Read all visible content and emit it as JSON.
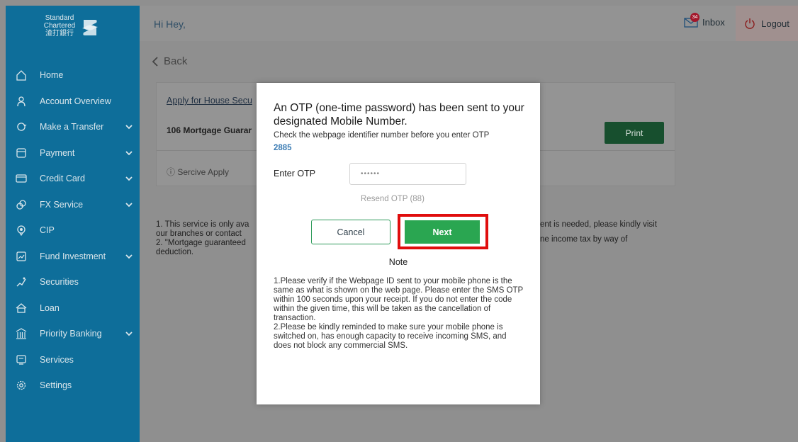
{
  "brand": {
    "line1": "Standard",
    "line2": "Chartered",
    "line3": "渣打銀行"
  },
  "sidebar": {
    "items": [
      {
        "label": "Home",
        "icon": "home-icon",
        "chevron": false
      },
      {
        "label": "Account Overview",
        "icon": "user-icon",
        "chevron": false
      },
      {
        "label": "Make a Transfer",
        "icon": "transfer-icon",
        "chevron": true
      },
      {
        "label": "Payment",
        "icon": "payment-icon",
        "chevron": true
      },
      {
        "label": "Credit Card",
        "icon": "credit-card-icon",
        "chevron": true
      },
      {
        "label": "FX Service",
        "icon": "fx-icon",
        "chevron": true
      },
      {
        "label": "CIP",
        "icon": "cip-icon",
        "chevron": false
      },
      {
        "label": "Fund Investment",
        "icon": "fund-icon",
        "chevron": true
      },
      {
        "label": "Securities",
        "icon": "securities-icon",
        "chevron": false
      },
      {
        "label": "Loan",
        "icon": "loan-icon",
        "chevron": false
      },
      {
        "label": "Priority Banking",
        "icon": "priority-banking-icon",
        "chevron": true
      },
      {
        "label": "Services",
        "icon": "services-icon",
        "chevron": false
      },
      {
        "label": "Settings",
        "icon": "settings-icon",
        "chevron": false
      }
    ]
  },
  "header": {
    "greeting": "Hi Hey,",
    "inbox_label": "Inbox",
    "inbox_badge": "34",
    "logout_label": "Logout"
  },
  "main": {
    "back_label": "Back",
    "card_link": "Apply for House Secu",
    "card_title": "106 Mortgage Guarar",
    "print_label": "Print",
    "service_label": "ⓘ Sercive Apply",
    "notes": {
      "line1": "1. This service is only ava",
      "line2": "our branches or contact",
      "line3": "2. \"Mortgage guaranteed",
      "line4": "deduction.",
      "right1": "ent is needed, please kindly visit",
      "right2": "ne income tax by way of"
    }
  },
  "modal": {
    "title": "An OTP (one-time password) has been sent to your designated Mobile Number.",
    "subtitle": "Check the webpage identifier number before you enter OTP",
    "identifier": "2885",
    "otp_label": "Enter OTP",
    "otp_value": "••••••",
    "resend_label": "Resend OTP (88)",
    "cancel_label": "Cancel",
    "next_label": "Next",
    "note_heading": "Note",
    "note_body_1": "1.Please verify if the Webpage ID sent to your mobile phone is the same as what is shown on the web page. Please enter the SMS OTP within 100 seconds upon your receipt. If you do not enter the code within the given time, this will be taken as the cancellation of transaction.",
    "note_body_2": "2.Please be kindly reminded to make sure your mobile phone is switched on, has enough capacity to receive incoming SMS, and does not block any commercial SMS."
  },
  "colors": {
    "sidebar_bg": "#0e6e9a",
    "next_button": "#2aa651",
    "highlight": "#e00d0d",
    "identifier": "#3b7cb4"
  }
}
